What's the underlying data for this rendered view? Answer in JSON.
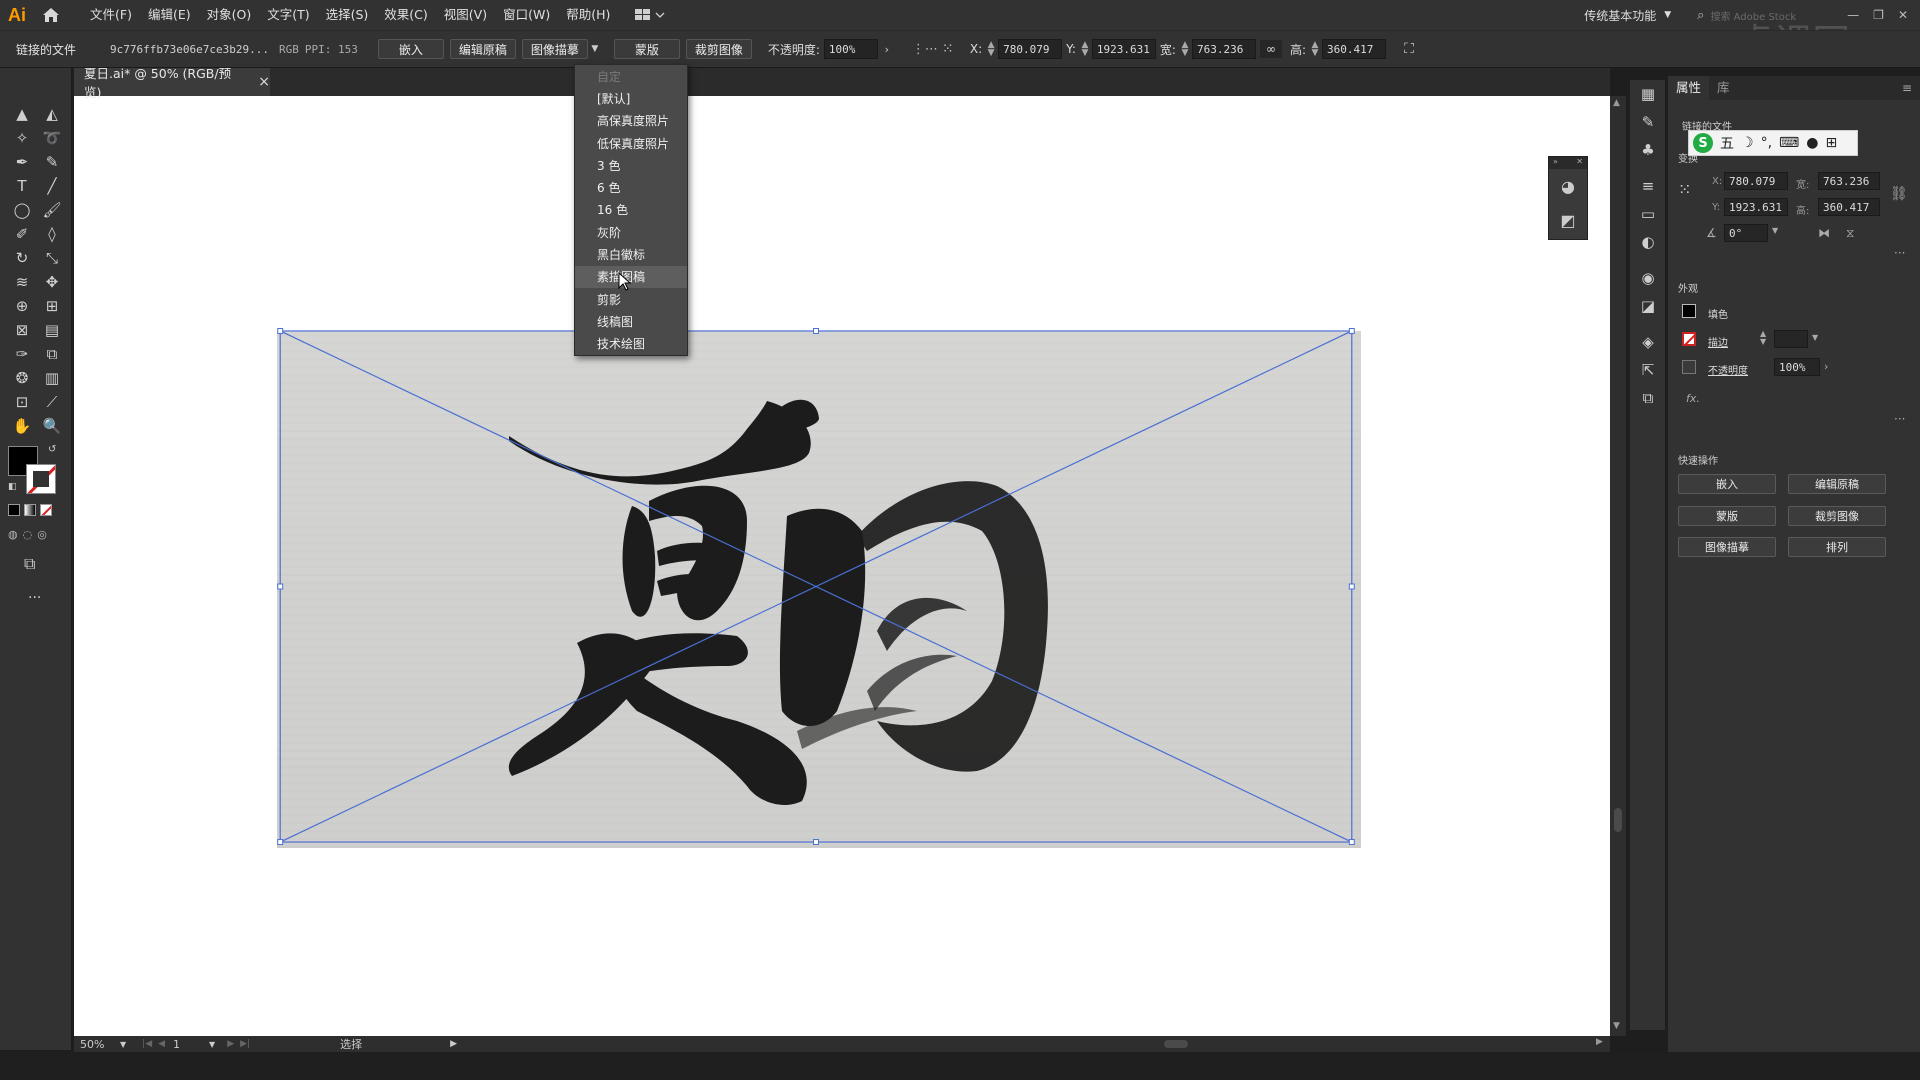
{
  "app": {
    "logo": "Ai"
  },
  "menu": {
    "items": [
      "文件(F)",
      "编辑(E)",
      "对象(O)",
      "文字(T)",
      "选择(S)",
      "效果(C)",
      "视图(V)",
      "窗口(W)",
      "帮助(H)"
    ],
    "workspace": "传统基本功能",
    "search_placeholder": "搜索 Adobe Stock"
  },
  "control_bar": {
    "linked_file_label": "链接的文件",
    "file_name": "9c776ffb73e06e7ce3b29...",
    "color_mode": "RGB",
    "ppi": "PPI: 153",
    "embed_btn": "嵌入",
    "edit_original_btn": "编辑原稿",
    "image_trace_btn": "图像描摹",
    "mask_btn": "蒙版",
    "crop_btn": "裁剪图像",
    "opacity_label": "不透明度:",
    "opacity_value": "100%",
    "x_label": "X:",
    "x_value": "780.079 \u001f",
    "y_label": "Y:",
    "y_value": "1923.631",
    "w_label": "宽:",
    "w_value": "763.236 \u001f",
    "h_label": "高:",
    "h_value": "360.417 \u001f"
  },
  "document_tab": {
    "title": "夏日.ai* @ 50% (RGB/预览)",
    "close": "×"
  },
  "trace_menu": {
    "items": [
      {
        "label": "自定",
        "disabled": true
      },
      {
        "label": "[默认]",
        "disabled": false
      },
      {
        "label": "高保真度照片",
        "disabled": false
      },
      {
        "label": "低保真度照片",
        "disabled": false
      },
      {
        "label": "3 色",
        "disabled": false
      },
      {
        "label": "6 色",
        "disabled": false
      },
      {
        "label": "16 色",
        "disabled": false
      },
      {
        "label": "灰阶",
        "disabled": false
      },
      {
        "label": "黑白徽标",
        "disabled": false
      },
      {
        "label": "素描图稿",
        "disabled": false,
        "hover": true
      },
      {
        "label": "剪影",
        "disabled": false
      },
      {
        "label": "线稿图",
        "disabled": false
      },
      {
        "label": "技术绘图",
        "disabled": false
      }
    ]
  },
  "status_bar": {
    "zoom": "50%",
    "page": "1",
    "tool": "选择"
  },
  "properties_panel": {
    "tabs": [
      "属性",
      "库"
    ],
    "linked_file_title": "链接的文件",
    "transform_title": "变换",
    "x_label": "X:",
    "x_value": "780.079",
    "y_label": "Y:",
    "y_value": "1923.631",
    "w_label": "宽:",
    "w_value": "763.236",
    "h_label": "高:",
    "h_value": "360.417",
    "angle_value": "0°",
    "appearance_title": "外观",
    "fill_label": "填色",
    "stroke_label": "描边",
    "opacity_label": "不透明度",
    "opacity_value": "100%",
    "fx_label": "fx.",
    "quick_actions_title": "快速操作",
    "quick_actions": [
      "嵌入",
      "编辑原稿",
      "蒙版",
      "裁剪图像",
      "图像描摹",
      "排列"
    ]
  },
  "ime": {
    "brand": "S",
    "mode": "五"
  },
  "colors": {
    "accent": "#ff9a00",
    "selection": "#4a6fd4",
    "ui_bg": "#323232"
  }
}
